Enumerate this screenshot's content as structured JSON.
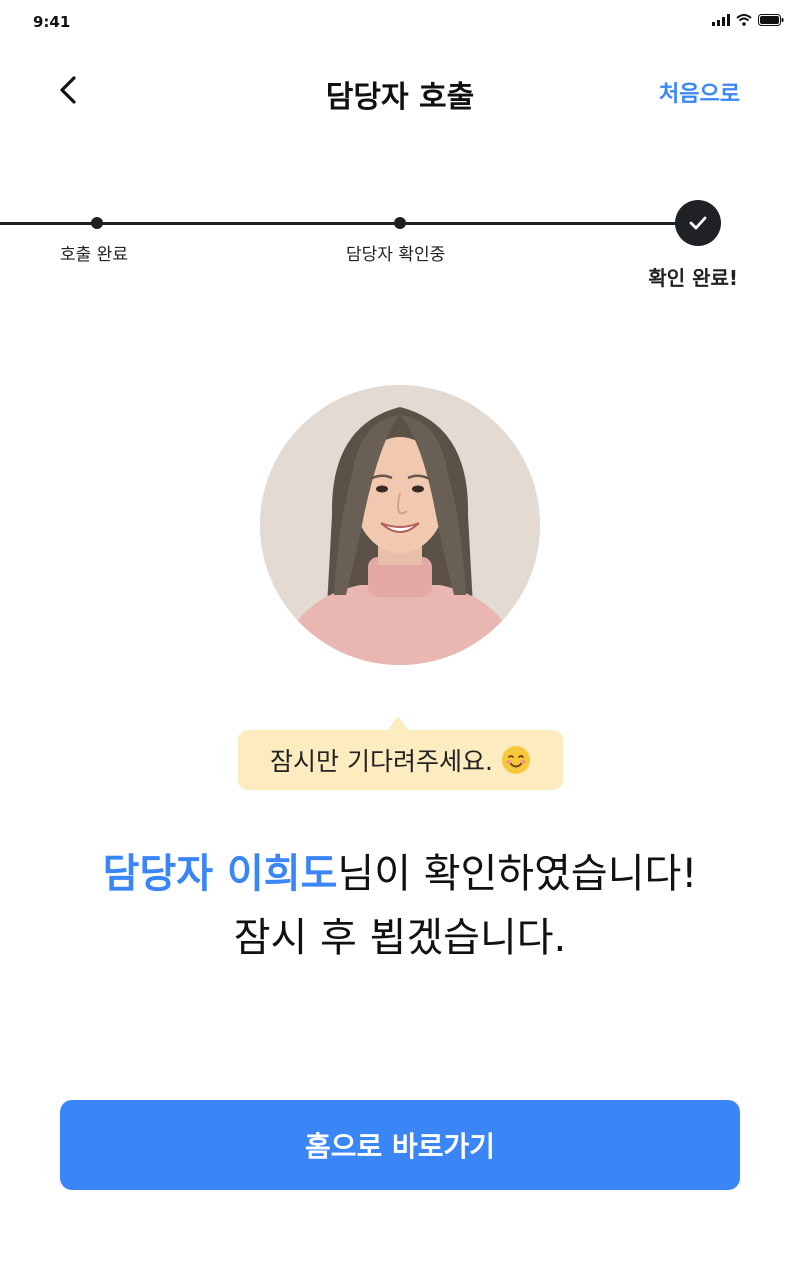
{
  "status_bar": {
    "time": "9:41"
  },
  "nav": {
    "title": "담당자 호출",
    "reset_label": "처음으로"
  },
  "steps": [
    {
      "label": "호출 완료",
      "state": "completed"
    },
    {
      "label": "담당자 확인중",
      "state": "completed"
    },
    {
      "label": "확인 완료!",
      "state": "current"
    }
  ],
  "tooltip": {
    "text": "잠시만 기다려주세요."
  },
  "message": {
    "highlight": "담당자 이희도",
    "line1_rest": "님이 확인하였습니다!",
    "line2": "잠시 후 뵙겠습니다."
  },
  "cta": {
    "label": "홈으로 바로가기"
  },
  "colors": {
    "accent": "#3b86f7",
    "tooltip_bg": "#fdecc0",
    "dark": "#1f2124"
  }
}
